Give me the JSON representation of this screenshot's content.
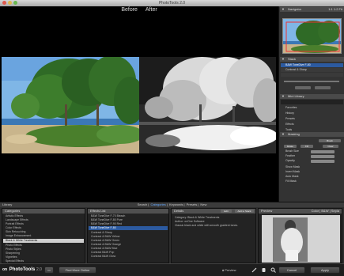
{
  "window": {
    "title": "PhotoTools 2.0"
  },
  "preview": {
    "before_label": "Before",
    "after_label": "After"
  },
  "sidebar": {
    "navigator": {
      "title": "Navigator",
      "zoom": "1:1 1:2 Fit"
    },
    "stack": {
      "title": "Stack",
      "items": [
        {
          "label": "B&W ToneDive F-80"
        },
        {
          "label": "Contrast & Sharp"
        }
      ]
    },
    "library": {
      "title": "Mini Library"
    },
    "sections": [
      "Favorites",
      "History",
      "Presets",
      "Effects",
      "Tools"
    ],
    "masking": {
      "title": "Masking",
      "buttons": [
        "Brush",
        "Erase",
        "Fill",
        "Clear"
      ],
      "options": [
        "Brush Size",
        "Feather",
        "Opacity"
      ],
      "checks": [
        "Show Mask",
        "Invert Mask",
        "Auto Mask",
        "Fill Mask"
      ]
    }
  },
  "library": {
    "header_label": "Library",
    "tabs": [
      "Search",
      "Categories",
      "Keywords",
      "Presets",
      "New"
    ],
    "active_tab": "Categories",
    "categories": {
      "title": "Categories",
      "items": [
        "Artistic Effects",
        "Landscape Effects",
        "Portrait Effects",
        "Color Effects",
        "Skin Retouching",
        "Image Enhancement",
        "Black & White Treatments",
        "Photo Effects",
        "Photo Styles",
        "Sharpening",
        "Vignettes",
        "Special Effects"
      ],
      "selected_index": 6
    },
    "effects": {
      "title": "Effects List",
      "items": [
        "B&W ToneDive F-70 Bleach",
        "B&W ToneDive F-80 Pure",
        "B&W ToneDive F-90 Red",
        "B&W ToneDive F-80",
        "Contrast & Sharp",
        "Contrast & B&W Yellow",
        "Contrast & B&W Green",
        "Contrast & B&W Orange",
        "Contrast & B&W Blue",
        "Contrast B&W Pop",
        "Contrast B&W Glow"
      ],
      "selected_index": 3
    },
    "details": {
      "title": "Details",
      "buttons": [
        "Edit",
        "Add to Stack"
      ],
      "lines": [
        "Category: Black & White Treatments",
        "Author: onOne Software",
        "Classic black and white with smooth gradient tones."
      ]
    },
    "preview": {
      "title": "Preview",
      "options": "Color | B&W | Sepia"
    }
  },
  "bottom_bar": {
    "app_name": "PhotoTools",
    "version": "2.0",
    "brand": "on",
    "find_more": "Find More Online",
    "preview_label": "Preview",
    "cancel": "Cancel",
    "apply": "Apply"
  },
  "colors": {
    "accent": "#2c5aa0",
    "background": "#2a2a2a"
  }
}
